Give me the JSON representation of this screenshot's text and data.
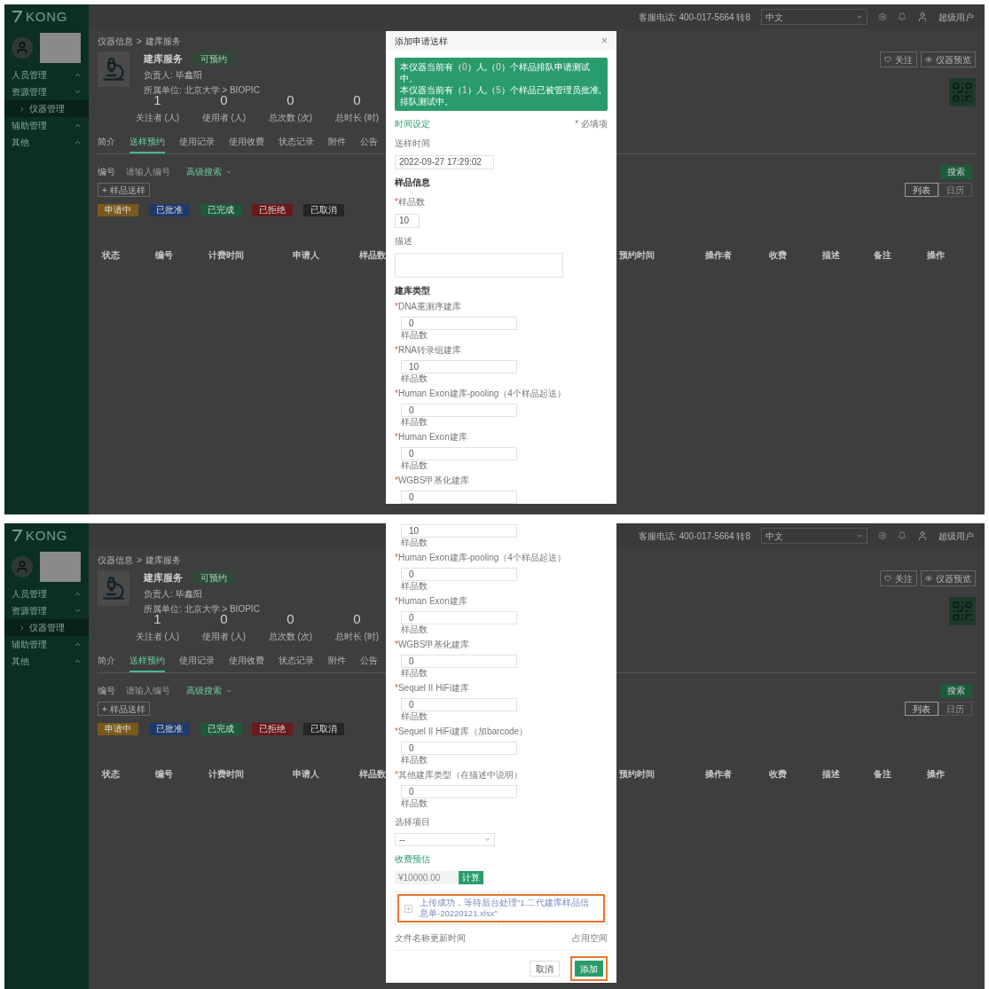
{
  "screens": [
    {
      "app": {
        "logo": "KONG",
        "menu": [
          {
            "label": "人员管理",
            "expanded": false
          },
          {
            "label": "资源管理",
            "expanded": true,
            "children": [
              {
                "label": "仪器管理",
                "selected": true
              }
            ]
          },
          {
            "label": "辅助管理",
            "expanded": false
          },
          {
            "label": "其他",
            "expanded": false
          }
        ],
        "topbar": {
          "phone": "客服电话: 400-017-5664 转8",
          "language": "中文",
          "user": "超级用户"
        },
        "breadcrumb": [
          "仪器信息",
          ">",
          "建库服务"
        ],
        "instrument": {
          "name": "建库服务",
          "status": "可预约",
          "owner": "负责人: 毕鑫阳",
          "org": "所属单位: 北京大学 > BIOPIC"
        },
        "actions": [
          "关注",
          "仪器预览"
        ],
        "stats": [
          {
            "value": "1",
            "label": "关注者 (人)"
          },
          {
            "value": "0",
            "label": "使用者 (人)"
          },
          {
            "value": "0",
            "label": "总次数 (次)"
          },
          {
            "value": "0",
            "label": "总时长 (时)"
          }
        ],
        "tabs": [
          {
            "label": "简介",
            "selected": false
          },
          {
            "label": "送样预约",
            "selected": true
          },
          {
            "label": "使用记录",
            "selected": false
          },
          {
            "label": "使用收费",
            "selected": false
          },
          {
            "label": "状态记录",
            "selected": false
          },
          {
            "label": "附件",
            "selected": false
          },
          {
            "label": "公告",
            "selected": false
          }
        ],
        "filter": {
          "label": "编号",
          "placeholder": "请输入编号",
          "advanced": "高级搜索"
        },
        "add_button": "+ 样品送样",
        "status_tags": [
          {
            "label": "申请中",
            "color": "#7a5a1a"
          },
          {
            "label": "已批准",
            "color": "#1f3a6a"
          },
          {
            "label": "已完成",
            "color": "#1d5a3a"
          },
          {
            "label": "已拒绝",
            "color": "#6a1a1a"
          },
          {
            "label": "已取消",
            "color": "#262626"
          }
        ],
        "search_button": "搜索",
        "views": [
          {
            "label": "列表",
            "selected": true
          },
          {
            "label": "日历",
            "selected": false
          }
        ],
        "columns": [
          "状态",
          "编号",
          "计费时间",
          "申请人",
          "样品数",
          "预约时间",
          "操作者",
          "收费",
          "描述",
          "备注",
          "操作"
        ]
      },
      "modal": {
        "title": "添加申请送样",
        "close": "×",
        "notice": [
          [
            "本仪器当前有（",
            "0",
            "）人,（",
            "0",
            "）个样品排队申请测试中。"
          ],
          [
            "本仪器当前有（",
            "1",
            "）人,（",
            "5",
            "）个样品已被管理员批准, 排队测试中。"
          ]
        ],
        "items": [
          {
            "kind": "header",
            "text": "时间设定",
            "accent": true,
            "note": "* 必填项"
          },
          {
            "kind": "label",
            "text": "送样时间"
          },
          {
            "kind": "datetime",
            "value": "2022-09-27 17:29:02"
          },
          {
            "kind": "header",
            "text": "样品信息",
            "accent": false
          },
          {
            "kind": "label",
            "mark": "*",
            "text": "样品数"
          },
          {
            "kind": "count",
            "value": "10"
          },
          {
            "kind": "label",
            "text": "描述"
          },
          {
            "kind": "textarea"
          },
          {
            "kind": "header",
            "text": "建库类型",
            "accent": false
          },
          {
            "kind": "library",
            "mark": "*",
            "label": "DNA重测序建库",
            "value": "0",
            "unit": "样品数"
          },
          {
            "kind": "library",
            "mark": "*",
            "label": "RNA转录组建库",
            "value": "10",
            "unit": "样品数"
          },
          {
            "kind": "library",
            "mark": "*",
            "label": "Human Exon建库-pooling（4个样品起送）",
            "value": "0",
            "unit": "样品数"
          },
          {
            "kind": "library",
            "mark": "*",
            "label": "Human Exon建库",
            "value": "0",
            "unit": "样品数"
          },
          {
            "kind": "library",
            "mark": "*",
            "label": "WGBS甲基化建库",
            "value": "0"
          }
        ]
      }
    },
    {
      "app": {
        "logo": "KONG",
        "menu": [
          {
            "label": "人员管理",
            "expanded": false
          },
          {
            "label": "资源管理",
            "expanded": true,
            "children": [
              {
                "label": "仪器管理",
                "selected": true
              }
            ]
          },
          {
            "label": "辅助管理",
            "expanded": false
          },
          {
            "label": "其他",
            "expanded": false
          }
        ],
        "topbar": {
          "phone": "客服电话: 400-017-5664 转8",
          "language": "中文",
          "user": "超级用户"
        },
        "breadcrumb": [
          "仪器信息",
          ">",
          "建库服务"
        ],
        "instrument": {
          "name": "建库服务",
          "status": "可预约",
          "owner": "负责人: 毕鑫阳",
          "org": "所属单位: 北京大学 > BIOPIC"
        },
        "actions": [
          "关注",
          "仪器预览"
        ],
        "stats": [
          {
            "value": "1",
            "label": "关注者 (人)"
          },
          {
            "value": "0",
            "label": "使用者 (人)"
          },
          {
            "value": "0",
            "label": "总次数 (次)"
          },
          {
            "value": "0",
            "label": "总时长 (时)"
          }
        ],
        "tabs": [
          {
            "label": "简介",
            "selected": false
          },
          {
            "label": "送样预约",
            "selected": true
          },
          {
            "label": "使用记录",
            "selected": false
          },
          {
            "label": "使用收费",
            "selected": false
          },
          {
            "label": "状态记录",
            "selected": false
          },
          {
            "label": "附件",
            "selected": false
          },
          {
            "label": "公告",
            "selected": false
          }
        ],
        "filter": {
          "label": "编号",
          "placeholder": "请输入编号",
          "advanced": "高级搜索"
        },
        "add_button": "+ 样品送样",
        "status_tags": [
          {
            "label": "申请中",
            "color": "#7a5a1a"
          },
          {
            "label": "已批准",
            "color": "#1f3a6a"
          },
          {
            "label": "已完成",
            "color": "#1d5a3a"
          },
          {
            "label": "已拒绝",
            "color": "#6a1a1a"
          },
          {
            "label": "已取消",
            "color": "#262626"
          }
        ],
        "search_button": "搜索",
        "views": [
          {
            "label": "列表",
            "selected": true
          },
          {
            "label": "日历",
            "selected": false
          }
        ],
        "columns": [
          "状态",
          "编号",
          "计费时间",
          "申请人",
          "样品数",
          "预约时间",
          "操作者",
          "收费",
          "描述",
          "备注",
          "操作"
        ]
      },
      "modal": {
        "items": [
          {
            "kind": "library",
            "value": "10",
            "unit": "样品数"
          },
          {
            "kind": "library",
            "mark": "*",
            "label": "Human Exon建库-pooling（4个样品起送）",
            "value": "0",
            "unit": "样品数"
          },
          {
            "kind": "library",
            "mark": "*",
            "label": "Human Exon建库",
            "value": "0",
            "unit": "样品数"
          },
          {
            "kind": "library",
            "mark": "*",
            "label": "WGBS甲基化建库",
            "value": "0",
            "unit": "样品数"
          },
          {
            "kind": "library",
            "mark": "*",
            "label": "Sequel II HiFi建库",
            "value": "0",
            "unit": "样品数"
          },
          {
            "kind": "library",
            "mark": "*",
            "label": "Sequel II HiFi建库（加barcode）",
            "value": "0",
            "unit": "样品数"
          },
          {
            "kind": "library",
            "mark": "*",
            "label": "其他建库类型（在描述中说明）",
            "value": "0",
            "unit": "样品数"
          },
          {
            "kind": "label",
            "text": "选择项目"
          },
          {
            "kind": "select",
            "value": "--"
          },
          {
            "kind": "header",
            "text": "收费预估",
            "accent": true
          },
          {
            "kind": "cost",
            "value": "¥10000.00",
            "button": "计算"
          },
          {
            "kind": "upload",
            "text": "上传成功，等待后台处理\"1.二代建库样品信息单-20220121.xlsx\"",
            "highlighted": true
          },
          {
            "kind": "files",
            "left": "文件名称更新时间",
            "right": "占用空间"
          }
        ],
        "footer": [
          {
            "label": "取消",
            "kind": "secondary",
            "highlighted": false
          },
          {
            "label": "添加",
            "kind": "primary",
            "highlighted": true
          }
        ]
      }
    }
  ]
}
